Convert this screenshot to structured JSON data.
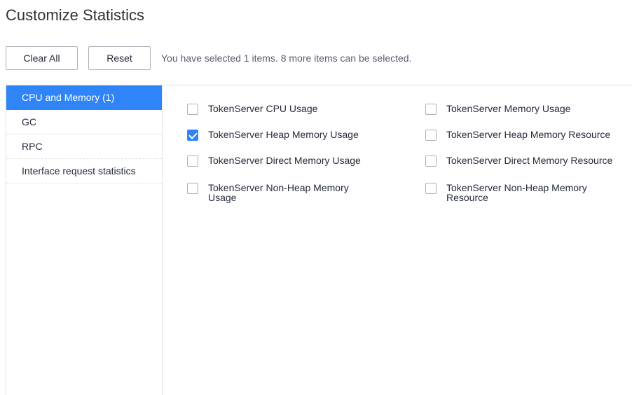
{
  "page": {
    "title": "Customize Statistics"
  },
  "toolbar": {
    "clear_all_label": "Clear All",
    "reset_label": "Reset",
    "selection_hint": "You have selected 1 items. 8 more items can be selected."
  },
  "sidebar": {
    "items": [
      {
        "label": "CPU and Memory (1)",
        "active": true
      },
      {
        "label": "GC",
        "active": false
      },
      {
        "label": "RPC",
        "active": false
      },
      {
        "label": "Interface request statistics",
        "active": false
      }
    ]
  },
  "options": [
    {
      "label": "TokenServer CPU Usage",
      "checked": false
    },
    {
      "label": "TokenServer Memory Usage",
      "checked": false
    },
    {
      "label": "TokenServer Heap Memory Usage",
      "checked": true
    },
    {
      "label": "TokenServer Heap Memory Resource",
      "checked": false
    },
    {
      "label": "TokenServer Direct Memory Usage",
      "checked": false
    },
    {
      "label": "TokenServer Direct Memory Resource",
      "checked": false
    },
    {
      "label": "TokenServer Non-Heap Memory Usage",
      "checked": false
    },
    {
      "label": "TokenServer Non-Heap Memory Resource",
      "checked": false
    }
  ],
  "colors": {
    "accent": "#2f84f7",
    "border": "#dfe1e6",
    "text": "#252b3a"
  }
}
